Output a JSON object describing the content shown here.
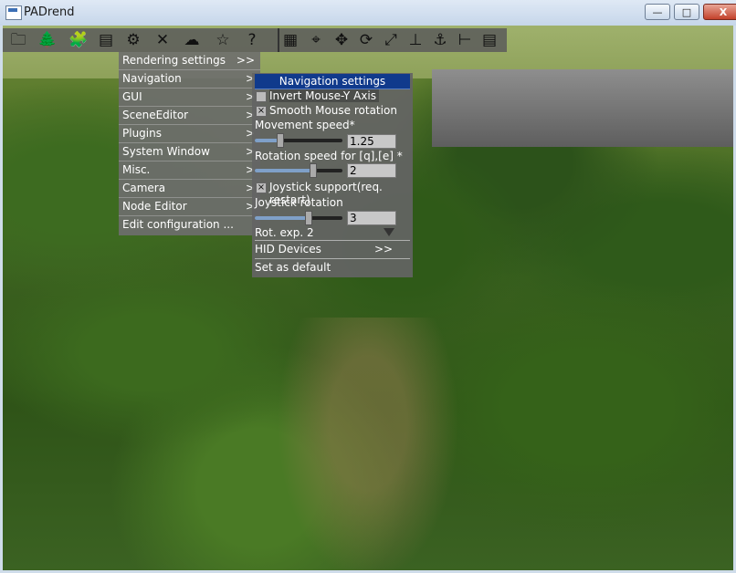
{
  "window": {
    "title": "PADrend",
    "minimize": "—",
    "maximize": "□",
    "close": "X"
  },
  "toolbar": {
    "icons": [
      "folder-icon",
      "tree-icon",
      "puzzle-icon",
      "list-icon",
      "gear-icon",
      "tools-icon",
      "weather-icon",
      "star-icon",
      "help-icon",
      "grid-numbers-icon",
      "camera-icon",
      "move-icon",
      "rotate-icon",
      "scale-icon",
      "drop-icon",
      "anchor-icon",
      "measure-icon",
      "notes-icon"
    ],
    "glyphs": [
      "🗀",
      "🌲",
      "🧩",
      "▤",
      "⚙",
      "✕",
      "☁",
      "☆",
      "?",
      "▦",
      "⌖",
      "✥",
      "⟳",
      "⤢",
      "⊥",
      "⚓",
      "⊢",
      "▤"
    ]
  },
  "main_menu": {
    "items": [
      {
        "label": "Rendering settings",
        "arrow": ">>"
      },
      {
        "label": "Navigation",
        "arrow": ">"
      },
      {
        "label": "GUI",
        "arrow": ">"
      },
      {
        "label": "SceneEditor",
        "arrow": ">"
      },
      {
        "label": "Plugins",
        "arrow": ">"
      },
      {
        "label": "System Window",
        "arrow": ">"
      },
      {
        "label": "Misc.",
        "arrow": ">"
      },
      {
        "label": "Camera",
        "arrow": ">"
      },
      {
        "label": "Node Editor",
        "arrow": ">"
      },
      {
        "label": "Edit configuration ...",
        "arrow": ""
      }
    ]
  },
  "navigation_settings": {
    "title": "Navigation settings",
    "invert_mouse_y": {
      "label": "Invert Mouse-Y Axis",
      "checked": false
    },
    "smooth_mouse_rotation": {
      "label": "Smooth Mouse rotation",
      "checked": true,
      "mark": "×"
    },
    "movement_speed": {
      "label": "Movement speed*",
      "value": "1.25",
      "level": 0.28
    },
    "rotation_speed": {
      "label": "Rotation speed for [q],[e] *",
      "value": "2",
      "level": 0.66
    },
    "joystick_support": {
      "label": "Joystick support(req. restart)",
      "checked": true,
      "mark": "×"
    },
    "joystick_rotation": {
      "label": "Joystick rotation",
      "value": "3",
      "level": 0.6
    },
    "rot_exp": {
      "label": "Rot. exp.",
      "value": "2"
    },
    "hid_devices": {
      "label": "HID Devices",
      "arrow": ">>"
    },
    "set_default": {
      "label": "Set as default"
    }
  }
}
